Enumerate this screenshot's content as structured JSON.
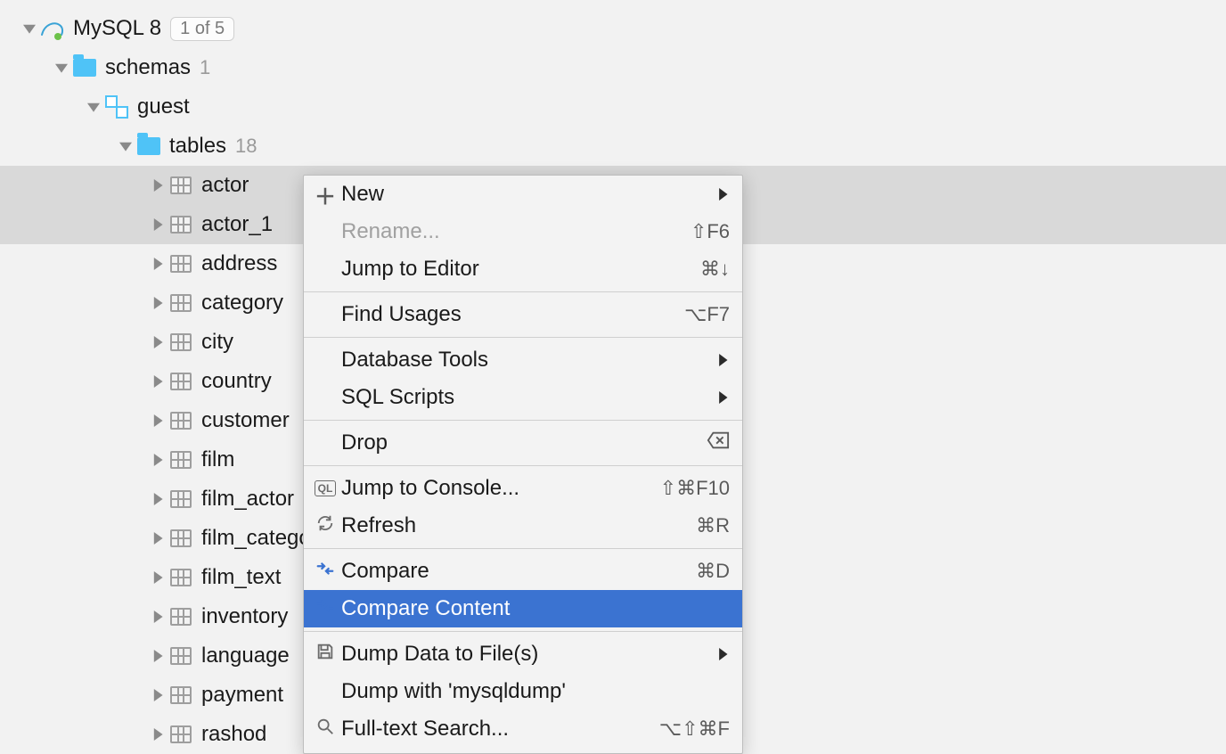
{
  "tree": {
    "datasource": {
      "name": "MySQL 8",
      "badge": "1 of 5"
    },
    "schemas": {
      "label": "schemas",
      "count": "1"
    },
    "schema": {
      "name": "guest"
    },
    "tables_node": {
      "label": "tables",
      "count": "18"
    },
    "tables": [
      "actor",
      "actor_1",
      "address",
      "category",
      "city",
      "country",
      "customer",
      "film",
      "film_actor",
      "film_category",
      "film_text",
      "inventory",
      "language",
      "payment",
      "rashod"
    ],
    "selected_indexes": [
      0,
      1
    ]
  },
  "context_menu": {
    "items": [
      {
        "label": "New",
        "submenu": true,
        "icon": "plus"
      },
      {
        "label": "Rename...",
        "shortcut": "⇧F6",
        "disabled": true
      },
      {
        "label": "Jump to Editor",
        "shortcut": "⌘↓"
      },
      {
        "sep": true
      },
      {
        "label": "Find Usages",
        "shortcut": "⌥F7"
      },
      {
        "sep": true
      },
      {
        "label": "Database Tools",
        "submenu": true
      },
      {
        "label": "SQL Scripts",
        "submenu": true
      },
      {
        "sep": true
      },
      {
        "label": "Drop",
        "shortcut_icon": "delete"
      },
      {
        "sep": true
      },
      {
        "label": "Jump to Console...",
        "shortcut": "⇧⌘F10",
        "icon": "ql"
      },
      {
        "label": "Refresh",
        "shortcut": "⌘R",
        "icon": "refresh"
      },
      {
        "sep": true
      },
      {
        "label": "Compare",
        "shortcut": "⌘D",
        "icon": "compare"
      },
      {
        "label": "Compare Content",
        "highlighted": true,
        "icon": "compare"
      },
      {
        "sep": true
      },
      {
        "label": "Dump Data to File(s)",
        "submenu": true,
        "icon": "save"
      },
      {
        "label": "Dump with 'mysqldump'"
      },
      {
        "label": "Full-text Search...",
        "shortcut": "⌥⇧⌘F",
        "icon": "search"
      }
    ]
  }
}
